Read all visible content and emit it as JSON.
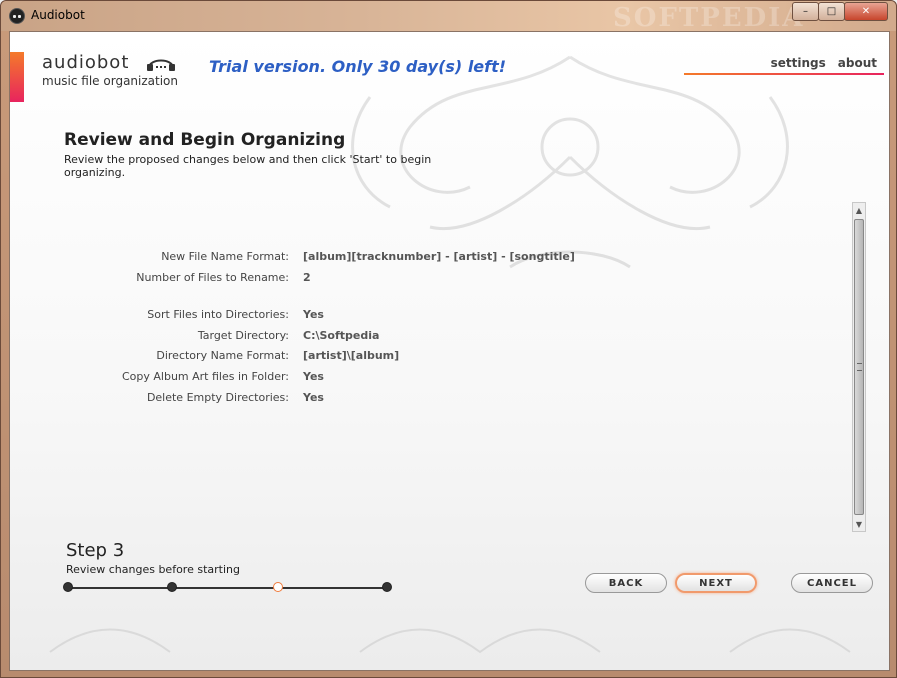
{
  "window": {
    "title": "Audiobot",
    "watermark": "SOFTPEDIA",
    "controls": {
      "minimize": "–",
      "maximize": "□",
      "close": "✕"
    }
  },
  "header": {
    "logo_name": "audiobot",
    "logo_icon": "headphones-icon",
    "tagline": "music file organization",
    "trial_text": "Trial version. Only 30 day(s) left!",
    "nav": [
      "settings",
      "about"
    ]
  },
  "page": {
    "title": "Review and Begin Organizing",
    "description": "Review the proposed changes below and then click 'Start' to begin organizing."
  },
  "summary": [
    {
      "label": "New File Name Format:",
      "value": "[album][tracknumber] - [artist] - [songtitle]"
    },
    {
      "label": "Number of Files to Rename:",
      "value": "2"
    },
    {
      "label": "Sort Files into Directories:",
      "value": "Yes"
    },
    {
      "label": "Target Directory:",
      "value": "C:\\Softpedia"
    },
    {
      "label": "Directory Name Format:",
      "value": "[artist]\\[album]"
    },
    {
      "label": "Copy Album Art files in Folder:",
      "value": "Yes"
    },
    {
      "label": "Delete Empty Directories:",
      "value": "Yes"
    }
  ],
  "step": {
    "title": "Step 3",
    "description": "Review changes before starting",
    "total": 4,
    "current": 3
  },
  "buttons": {
    "back": "BACK",
    "next": "NEXT",
    "cancel": "CANCEL"
  },
  "colors": {
    "accent_orange": "#f47a2a",
    "accent_pink": "#e8245e",
    "trial_blue": "#2d5fc4"
  }
}
